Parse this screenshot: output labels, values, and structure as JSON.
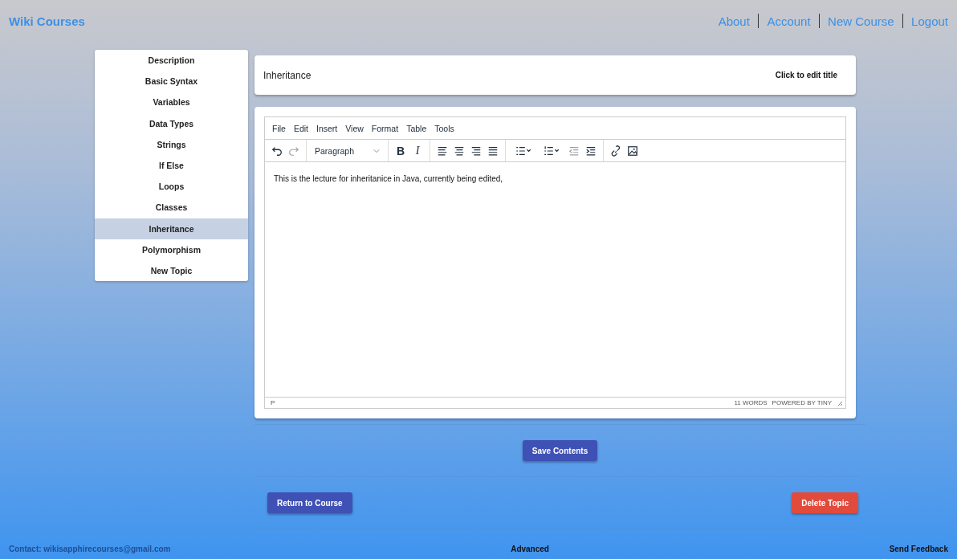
{
  "header": {
    "brand": "Wiki Courses",
    "nav": [
      "About",
      "Account",
      "New Course",
      "Logout"
    ]
  },
  "sidebar": {
    "items": [
      {
        "label": "Description",
        "selected": false
      },
      {
        "label": "Basic Syntax",
        "selected": false
      },
      {
        "label": "Variables",
        "selected": false
      },
      {
        "label": "Data Types",
        "selected": false
      },
      {
        "label": "Strings",
        "selected": false
      },
      {
        "label": "If Else",
        "selected": false
      },
      {
        "label": "Loops",
        "selected": false
      },
      {
        "label": "Classes",
        "selected": false
      },
      {
        "label": "Inheritance",
        "selected": true
      },
      {
        "label": "Polymorphism",
        "selected": false
      },
      {
        "label": "New Topic",
        "selected": false
      }
    ]
  },
  "title_card": {
    "title": "Inheritance",
    "edit_hint": "Click to edit title"
  },
  "editor": {
    "menu": [
      "File",
      "Edit",
      "Insert",
      "View",
      "Format",
      "Table",
      "Tools"
    ],
    "block_format": "Paragraph",
    "bold": "B",
    "italic": "I",
    "content": "This is the lecture for inheritanice in Java, currently being edited,",
    "path": "P",
    "word_count": "11 WORDS",
    "branding": "POWERED BY TINY"
  },
  "save_button": "Save Contents",
  "return_button": "Return to Course",
  "delete_button": "Delete Topic",
  "footer": {
    "contact": "Contact: wikisapphirecourses@gmail.com",
    "advanced": "Advanced",
    "feedback": "Send Feedback"
  }
}
